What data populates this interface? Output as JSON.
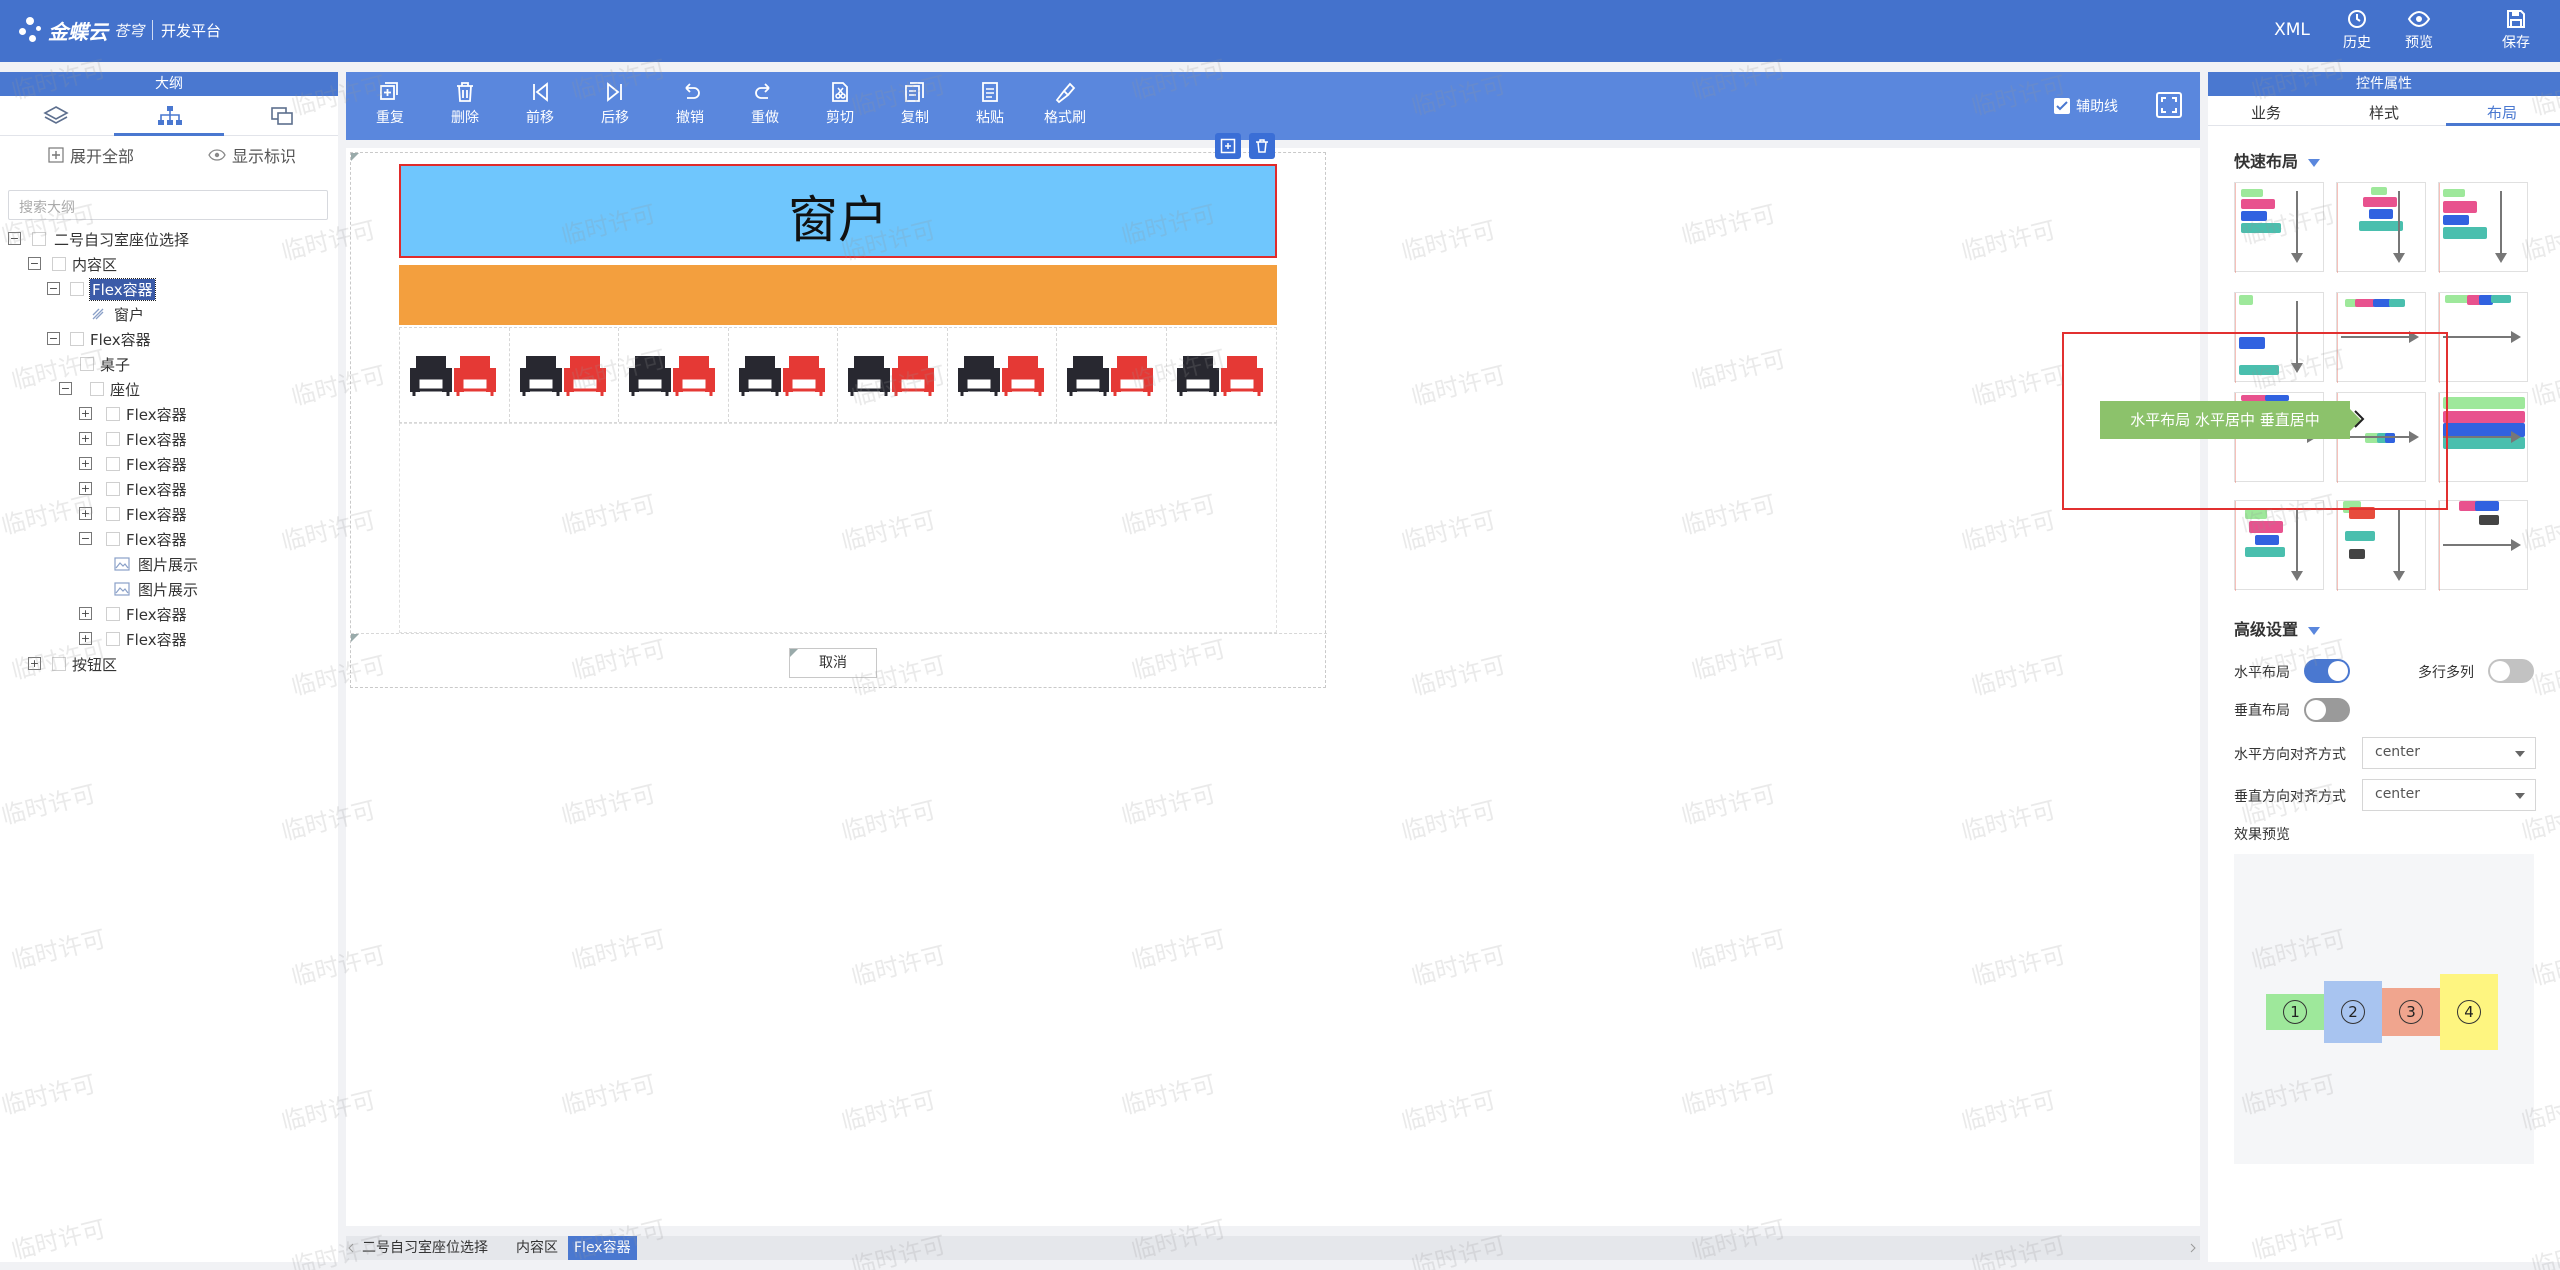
{
  "header": {
    "brand_name": "金蝶云",
    "brand_sub": "苍穹",
    "platform": "开发平台",
    "xml_label": "XML",
    "history_label": "历史",
    "preview_label": "预览",
    "save_label": "保存"
  },
  "outline": {
    "title": "大纲",
    "expand_all": "展开全部",
    "show_marks": "显示标识",
    "search_placeholder": "搜索大纲",
    "tree": [
      {
        "label": "二号自习室座位选择",
        "toggle": "−"
      },
      {
        "label": "内容区",
        "toggle": "−"
      },
      {
        "label": "Flex容器",
        "toggle": "−",
        "selected": true
      },
      {
        "label": "窗户",
        "toggle": ""
      },
      {
        "label": "Flex容器",
        "toggle": "−"
      },
      {
        "label": "桌子",
        "toggle": ""
      },
      {
        "label": "座位",
        "toggle": "−"
      },
      {
        "label": "Flex容器",
        "toggle": "+"
      },
      {
        "label": "Flex容器",
        "toggle": "+"
      },
      {
        "label": "Flex容器",
        "toggle": "+"
      },
      {
        "label": "Flex容器",
        "toggle": "+"
      },
      {
        "label": "Flex容器",
        "toggle": "+"
      },
      {
        "label": "Flex容器",
        "toggle": "−"
      },
      {
        "label": "图片展示",
        "toggle": ""
      },
      {
        "label": "图片展示",
        "toggle": ""
      },
      {
        "label": "Flex容器",
        "toggle": "+"
      },
      {
        "label": "Flex容器",
        "toggle": "+"
      },
      {
        "label": "按钮区",
        "toggle": "+"
      }
    ]
  },
  "toolbar": {
    "buttons": [
      "重复",
      "删除",
      "前移",
      "后移",
      "撤销",
      "重做",
      "剪切",
      "复制",
      "粘贴",
      "格式刷"
    ],
    "aux_lines": "辅助线"
  },
  "canvas": {
    "window_text": "窗户",
    "cancel_button": "取消",
    "seat_count": 8
  },
  "breadcrumb": [
    "二号自习室座位选择",
    "内容区",
    "Flex容器"
  ],
  "props": {
    "title": "控件属性",
    "tabs": [
      "业务",
      "样式",
      "布局"
    ],
    "active_tab": "布局",
    "quick_layout": "快速布局",
    "tooltip": "水平布局 水平居中 垂直居中",
    "advanced": "高级设置",
    "horizontal_layout": "水平布局",
    "horizontal_on": true,
    "multi_row": "多行多列",
    "multi_row_on": false,
    "vertical_layout": "垂直布局",
    "vertical_on": false,
    "h_align_label": "水平方向对齐方式",
    "h_align_value": "center",
    "v_align_label": "垂直方向对齐方式",
    "v_align_value": "center",
    "preview_label": "效果预览",
    "preview_items": [
      "1",
      "2",
      "3",
      "4"
    ]
  },
  "watermark": "临时许可",
  "colors": {
    "header": "#4472cc",
    "toolbar": "#5a87dd",
    "window": "#6fc6fd",
    "orange_bar": "#f39f3e",
    "tooltip": "#8cc26b"
  }
}
